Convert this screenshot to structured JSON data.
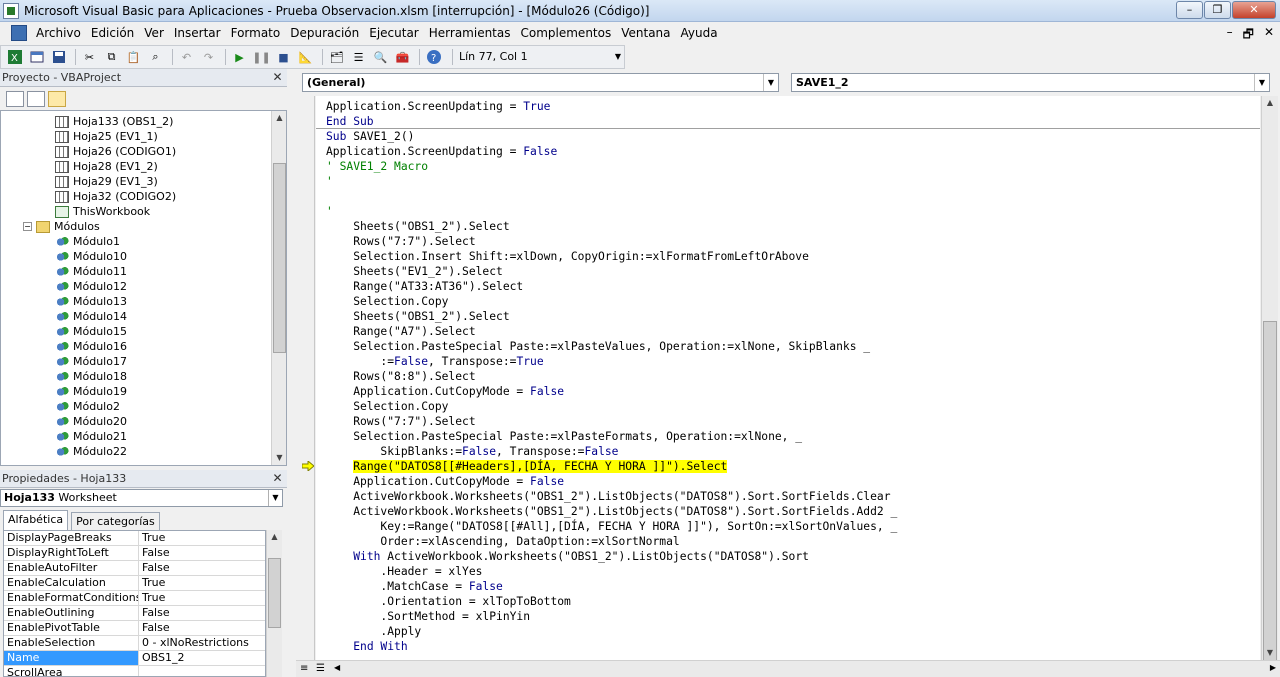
{
  "window": {
    "title": "Microsoft Visual Basic para Aplicaciones - Prueba Observacion.xlsm [interrupción] - [Módulo26 (Código)]",
    "minimize": "–",
    "restore": "❐",
    "close": "✕"
  },
  "menu": {
    "items": [
      "Archivo",
      "Edición",
      "Ver",
      "Insertar",
      "Formato",
      "Depuración",
      "Ejecutar",
      "Herramientas",
      "Complementos",
      "Ventana",
      "Ayuda"
    ],
    "mdi_minimize": "–",
    "mdi_restore": "🗗",
    "mdi_close": "✕"
  },
  "toolbar": {
    "position": "Lín 77, Col 1"
  },
  "project": {
    "title": "Proyecto - VBAProject",
    "tree": [
      {
        "label": "Hoja133 (OBS1_2)",
        "icon": "sheet-icon",
        "indent": 1
      },
      {
        "label": "Hoja25 (EV1_1)",
        "icon": "sheet-icon",
        "indent": 1
      },
      {
        "label": "Hoja26 (CODIGO1)",
        "icon": "sheet-icon",
        "indent": 1
      },
      {
        "label": "Hoja28 (EV1_2)",
        "icon": "sheet-icon",
        "indent": 1
      },
      {
        "label": "Hoja29 (EV1_3)",
        "icon": "sheet-icon",
        "indent": 1
      },
      {
        "label": "Hoja32 (CODIGO2)",
        "icon": "sheet-icon",
        "indent": 1
      },
      {
        "label": "ThisWorkbook",
        "icon": "workbook-icon",
        "indent": 1
      },
      {
        "label": "Módulos",
        "icon": "folder-icon",
        "indent": 0,
        "expander": "−"
      },
      {
        "label": "Módulo1",
        "icon": "module-icon",
        "indent": 1
      },
      {
        "label": "Módulo10",
        "icon": "module-icon",
        "indent": 1
      },
      {
        "label": "Módulo11",
        "icon": "module-icon",
        "indent": 1
      },
      {
        "label": "Módulo12",
        "icon": "module-icon",
        "indent": 1
      },
      {
        "label": "Módulo13",
        "icon": "module-icon",
        "indent": 1
      },
      {
        "label": "Módulo14",
        "icon": "module-icon",
        "indent": 1
      },
      {
        "label": "Módulo15",
        "icon": "module-icon",
        "indent": 1
      },
      {
        "label": "Módulo16",
        "icon": "module-icon",
        "indent": 1
      },
      {
        "label": "Módulo17",
        "icon": "module-icon",
        "indent": 1
      },
      {
        "label": "Módulo18",
        "icon": "module-icon",
        "indent": 1
      },
      {
        "label": "Módulo19",
        "icon": "module-icon",
        "indent": 1
      },
      {
        "label": "Módulo2",
        "icon": "module-icon",
        "indent": 1
      },
      {
        "label": "Módulo20",
        "icon": "module-icon",
        "indent": 1
      },
      {
        "label": "Módulo21",
        "icon": "module-icon",
        "indent": 1
      },
      {
        "label": "Módulo22",
        "icon": "module-icon",
        "indent": 1
      }
    ]
  },
  "properties": {
    "title": "Propiedades - Hoja133",
    "object_name": "Hoja133",
    "object_type": "Worksheet",
    "tabs": [
      "Alfabética",
      "Por categorías"
    ],
    "rows": [
      {
        "name": "DisplayPageBreaks",
        "value": "True"
      },
      {
        "name": "DisplayRightToLeft",
        "value": "False"
      },
      {
        "name": "EnableAutoFilter",
        "value": "False"
      },
      {
        "name": "EnableCalculation",
        "value": "True"
      },
      {
        "name": "EnableFormatConditionsCalculation",
        "value": "True"
      },
      {
        "name": "EnableOutlining",
        "value": "False"
      },
      {
        "name": "EnablePivotTable",
        "value": "False"
      },
      {
        "name": "EnableSelection",
        "value": "0 - xlNoRestrictions"
      },
      {
        "name": "Name",
        "value": "OBS1_2",
        "selected": true
      },
      {
        "name": "ScrollArea",
        "value": ""
      }
    ]
  },
  "code": {
    "object_combo": "(General)",
    "proc_combo": "SAVE1_2",
    "lines": [
      [
        [
          "",
          "Application.ScreenUpdating = "
        ],
        [
          "kw",
          "True"
        ]
      ],
      [
        [
          "kw",
          "End Sub"
        ]
      ],
      [
        [
          "kw",
          "Sub"
        ],
        [
          "",
          " SAVE1_2()"
        ]
      ],
      [
        [
          "",
          "Application.ScreenUpdating = "
        ],
        [
          "kw",
          "False"
        ]
      ],
      [
        [
          "cm",
          "' SAVE1_2 Macro"
        ]
      ],
      [
        [
          "cm",
          "'"
        ]
      ],
      [
        [
          "",
          ""
        ]
      ],
      [
        [
          "cm",
          "'"
        ]
      ],
      [
        [
          "",
          "    Sheets(\"OBS1_2\").Select"
        ]
      ],
      [
        [
          "",
          "    Rows(\"7:7\").Select"
        ]
      ],
      [
        [
          "",
          "    Selection.Insert Shift:=xlDown, CopyOrigin:=xlFormatFromLeftOrAbove"
        ]
      ],
      [
        [
          "",
          "    Sheets(\"EV1_2\").Select"
        ]
      ],
      [
        [
          "",
          "    Range(\"AT33:AT36\").Select"
        ]
      ],
      [
        [
          "",
          "    Selection.Copy"
        ]
      ],
      [
        [
          "",
          "    Sheets(\"OBS1_2\").Select"
        ]
      ],
      [
        [
          "",
          "    Range(\"A7\").Select"
        ]
      ],
      [
        [
          "",
          "    Selection.PasteSpecial Paste:=xlPasteValues, Operation:=xlNone, SkipBlanks _"
        ]
      ],
      [
        [
          "",
          "        :="
        ],
        [
          "kw",
          "False"
        ],
        [
          "",
          ", Transpose:="
        ],
        [
          "kw",
          "True"
        ]
      ],
      [
        [
          "",
          "    Rows(\"8:8\").Select"
        ]
      ],
      [
        [
          "",
          "    Application.CutCopyMode = "
        ],
        [
          "kw",
          "False"
        ]
      ],
      [
        [
          "",
          "    Selection.Copy"
        ]
      ],
      [
        [
          "",
          "    Rows(\"7:7\").Select"
        ]
      ],
      [
        [
          "",
          "    Selection.PasteSpecial Paste:=xlPasteFormats, Operation:=xlNone, _"
        ]
      ],
      [
        [
          "",
          "        SkipBlanks:="
        ],
        [
          "kw",
          "False"
        ],
        [
          "",
          ", Transpose:="
        ],
        [
          "kw",
          "False"
        ]
      ],
      [
        [
          "",
          "    "
        ],
        [
          "hl",
          "Range(\"DATOS8[[#Headers],[DÍA, FECHA Y HORA ]]\").Select"
        ]
      ],
      [
        [
          "",
          "    Application.CutCopyMode = "
        ],
        [
          "kw",
          "False"
        ]
      ],
      [
        [
          "",
          "    ActiveWorkbook.Worksheets(\"OBS1_2\").ListObjects(\"DATOS8\").Sort.SortFields.Clear"
        ]
      ],
      [
        [
          "",
          "    ActiveWorkbook.Worksheets(\"OBS1_2\").ListObjects(\"DATOS8\").Sort.SortFields.Add2 _"
        ]
      ],
      [
        [
          "",
          "        Key:=Range(\"DATOS8[[#All],[DÍA, FECHA Y HORA ]]\"), SortOn:=xlSortOnValues, _"
        ]
      ],
      [
        [
          "",
          "        Order:=xlAscending, DataOption:=xlSortNormal"
        ]
      ],
      [
        [
          "",
          "    "
        ],
        [
          "kw",
          "With"
        ],
        [
          "",
          " ActiveWorkbook.Worksheets(\"OBS1_2\").ListObjects(\"DATOS8\").Sort"
        ]
      ],
      [
        [
          "",
          "        .Header = xlYes"
        ]
      ],
      [
        [
          "",
          "        .MatchCase = "
        ],
        [
          "kw",
          "False"
        ]
      ],
      [
        [
          "",
          "        .Orientation = xlTopToBottom"
        ]
      ],
      [
        [
          "",
          "        .SortMethod = xlPinYin"
        ]
      ],
      [
        [
          "",
          "        .Apply"
        ]
      ],
      [
        [
          "",
          "    "
        ],
        [
          "kw",
          "End With"
        ]
      ]
    ]
  },
  "colors": {
    "keyword": "#00008b",
    "comment": "#008000",
    "highlight": "#ffff00",
    "exec_arrow": "#ffff00"
  }
}
